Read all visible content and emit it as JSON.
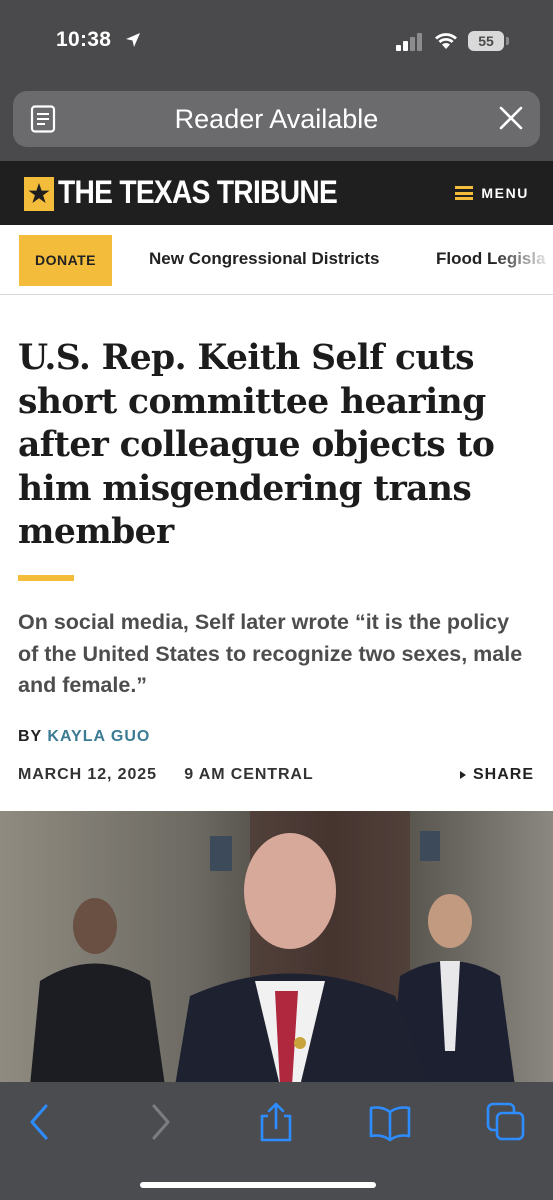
{
  "status_bar": {
    "time": "10:38",
    "battery": "55"
  },
  "safari": {
    "reader_label": "Reader Available"
  },
  "site": {
    "logo_text": "THE TEXAS TRIBUNE",
    "menu_label": "MENU",
    "brand_color": "#f4bc3b"
  },
  "nav": {
    "donate_label": "DONATE",
    "links": [
      "New Congressional Districts",
      "Flood Legisla"
    ]
  },
  "article": {
    "headline": "U.S. Rep. Keith Self cuts short committee hearing after colleague objects to him misgendering trans member",
    "dek": "On social media, Self later wrote “it is the policy of the United States to recognize two sexes, male and female.”",
    "byline_prefix": "BY",
    "author": "KAYLA GUO",
    "date": "MARCH 12, 2025",
    "time": "9 AM CENTRAL",
    "share_label": "SHARE"
  },
  "toolbar": {
    "icons": [
      "back-icon",
      "forward-icon",
      "share-icon",
      "bookmarks-icon",
      "tabs-icon"
    ]
  }
}
